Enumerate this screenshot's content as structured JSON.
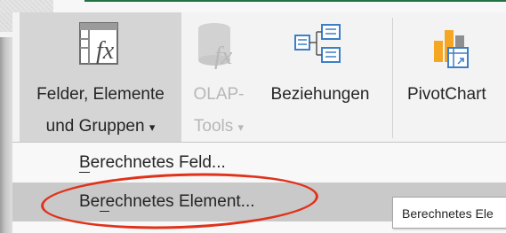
{
  "ribbon": {
    "fields_button": {
      "line1": "Felder, Elemente",
      "line2": "und Gruppen",
      "dropdown": "▾",
      "icon": "fields-items-sets-fx-icon"
    },
    "olap_button": {
      "line1": "OLAP-",
      "line2": "Tools",
      "dropdown": "▾",
      "icon": "olap-cylinder-fx-icon",
      "disabled": true
    },
    "relationships_button": {
      "label": "Beziehungen",
      "icon": "relationships-diagram-icon"
    },
    "pivotchart_button": {
      "label": "PivotChart",
      "icon": "pivotchart-icon"
    }
  },
  "menu": {
    "items": [
      {
        "label": "Berechnetes Feld...",
        "hotkey": "B",
        "highlighted": false
      },
      {
        "label": "Berechnetes Element...",
        "hotkey": "e",
        "highlighted": true
      }
    ]
  },
  "tooltip": {
    "text": "Berechnetes Ele"
  },
  "colors": {
    "accent_green": "#217346",
    "hover_gray": "#d5d5d5",
    "menu_highlight": "#c9c9c9",
    "annotation_red": "#e0321a",
    "olap_blue": "#5b9bd5",
    "chart_orange": "#f5a623"
  }
}
